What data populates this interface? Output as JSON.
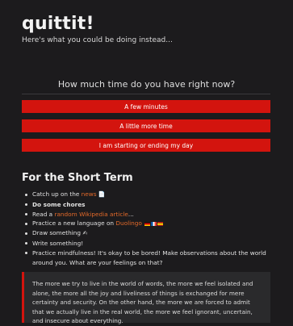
{
  "header": {
    "title": "quittit!",
    "tagline": "Here's what you could be doing instead..."
  },
  "time_prompt": {
    "question": "How much time do you have right now?",
    "options": [
      "A few minutes",
      "A little more time",
      "I am starting or ending my day"
    ]
  },
  "colors": {
    "accent": "#d3140e",
    "link": "#e36a2a",
    "background": "#1c1b1d",
    "quote_background": "#2a2a2c"
  },
  "short_term": {
    "heading": "For the Short Term",
    "items": [
      {
        "pre": "Catch up on the ",
        "link": "news",
        "post": "",
        "icon": "newspaper-icon",
        "icon_glyph": "📄"
      },
      {
        "text": "Do some chores"
      },
      {
        "pre": "Read a ",
        "link": "random Wikipedia article",
        "post": "..."
      },
      {
        "pre": "Practice a new language on ",
        "link": "Duolingo",
        "post": "",
        "flags": [
          "de",
          "fr",
          "es"
        ]
      },
      {
        "pre": "Draw something ",
        "icon": "writing-hand-icon",
        "icon_glyph": "✍"
      },
      {
        "text": "Write something!"
      },
      {
        "text": "Practice mindfulness! It's okay to be bored! Make observations about the world around you. What are your feelings on that?"
      }
    ]
  },
  "quote": {
    "text": "The more we try to live in the world of words, the more we feel isolated and alone, the more all the joy and liveliness of things is exchanged for mere certainty and security. On the other hand, the more we are forced to admit that we actually live in the real world, the more we feel ignorant, uncertain, and insecure about everything."
  }
}
